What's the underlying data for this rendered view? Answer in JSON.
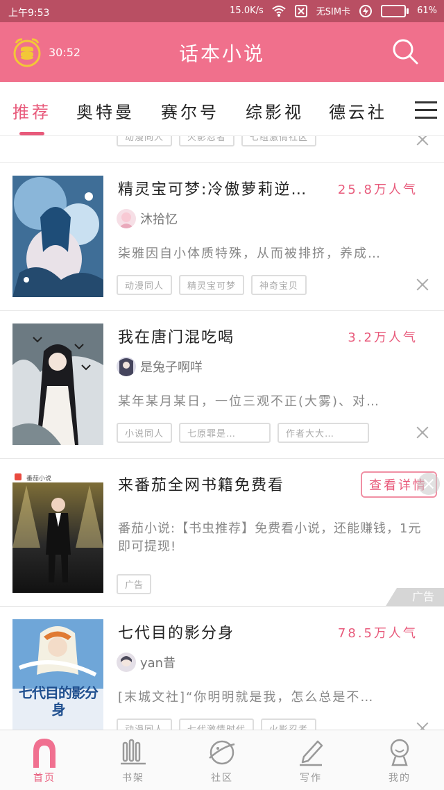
{
  "status_bar": {
    "time": "上午9:53",
    "speed": "15.0K/s",
    "sim": "无SIM卡",
    "battery": "61%"
  },
  "header": {
    "timer": "30:52",
    "title": "话本小说"
  },
  "tabs": [
    "推荐",
    "奥特曼",
    "赛尔号",
    "综影视",
    "德云社"
  ],
  "feed": [
    {
      "title": "精灵宝可梦:冷傲萝莉逆…",
      "popularity": "25.8万人气",
      "author": "沐拾忆",
      "desc": "柒雅因自小体质特殊，从而被排挤，养成…",
      "tags": [
        "动漫同人",
        "精灵宝可梦",
        "神奇宝贝"
      ]
    },
    {
      "title": "我在唐门混吃喝",
      "popularity": "3.2万人气",
      "author": "是兔子啊咩",
      "desc": "某年某月某日，一位三观不正(大雾)、对…",
      "tags": [
        "小说同人",
        "七原罪是…",
        "作者大大…"
      ]
    },
    {
      "ad": true,
      "title": "来番茄全网书籍免费看",
      "button": "查看详情",
      "desc": "番茄小说:【书虫推荐】免费看小说，还能赚钱，1元即可提现!",
      "tag": "广告",
      "corner": "广告",
      "cover_caption": "番茄小说"
    },
    {
      "title": "七代目的影分身",
      "popularity": "78.5万人气",
      "author": "yan昔",
      "desc": "[末城文社]“你明明就是我，怎么总是不…",
      "tags": [
        "动漫同人",
        "七代激情时代",
        "火影忍者"
      ],
      "cover_text": "七代目的影分身"
    }
  ],
  "top_partial_tags": [
    "动漫同人",
    "火影忍者",
    "七组激情社区"
  ],
  "bottom_nav": [
    {
      "label": "首页",
      "icon": "home-icon"
    },
    {
      "label": "书架",
      "icon": "bookshelf-icon"
    },
    {
      "label": "社区",
      "icon": "planet-icon"
    },
    {
      "label": "写作",
      "icon": "pen-icon"
    },
    {
      "label": "我的",
      "icon": "profile-icon"
    }
  ],
  "colors": {
    "accent": "#e85a7b",
    "header": "#f0708c",
    "status": "#b94f63"
  }
}
